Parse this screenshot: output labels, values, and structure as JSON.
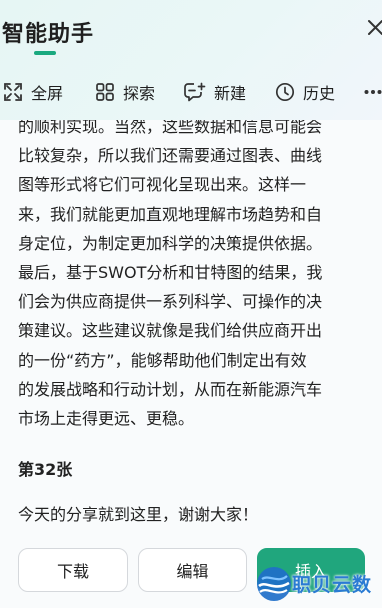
{
  "app": {
    "title": "智能助手",
    "accent_color": "#1aa97f"
  },
  "toolbar": {
    "items": [
      {
        "label": "全屏",
        "icon": "fullscreen-icon"
      },
      {
        "label": "探索",
        "icon": "grid-icon"
      },
      {
        "label": "新建",
        "icon": "new-chat-icon"
      },
      {
        "label": "历史",
        "icon": "clock-icon"
      }
    ],
    "more_icon": "more-dots-icon",
    "close_icon": "close-icon"
  },
  "content": {
    "paragraph_lines": [
      "的顺利实现。当然，这些数据和信息可能会",
      "比较复杂，所以我们还需要通过图表、曲线",
      "图等形式将它们可视化呈现出来。这样一",
      "来，我们就能更加直观地理解市场趋势和自",
      "身定位，为制定更加科学的决策提供依据。",
      "最后，基于SWOT分析和甘特图的结果，我",
      "们会为供应商提供一系列科学、可操作的决",
      "策建议。这些建议就像是我们给供应商开出",
      "的一份“药方”，能够帮助他们制定出有效",
      "的发展战略和行动计划，从而在新能源汽车",
      "市场上走得更远、更稳。"
    ],
    "slide_heading": "第32张",
    "closing_text": "今天的分享就到这里，谢谢大家！"
  },
  "actions": {
    "download": "下载",
    "edit": "编辑",
    "insert": "插入",
    "primary_color": "#20a67d"
  },
  "watermark": {
    "text": "职贝云数"
  }
}
